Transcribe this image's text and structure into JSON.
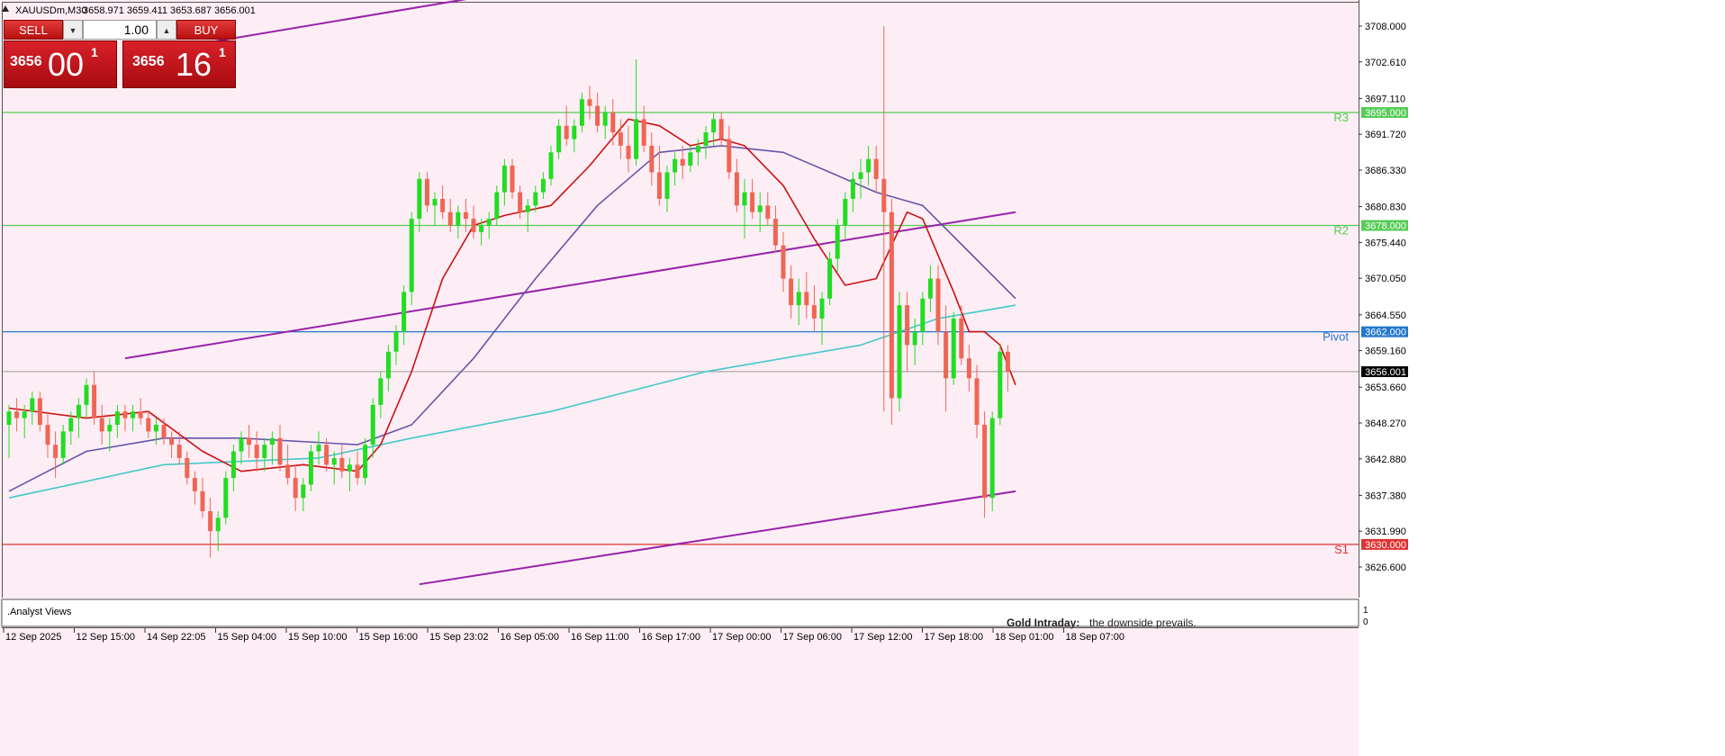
{
  "header": {
    "symbol_text": "XAUUSDm,M30",
    "ohlc_text": "3658.971 3659.411 3653.687 3656.001"
  },
  "trade_panel": {
    "sell_label": "SELL",
    "buy_label": "BUY",
    "lot_value": "1.00",
    "sell_price_big": "3656",
    "sell_price_large": "00",
    "sell_price_sup": "1",
    "buy_price_big": "3656",
    "buy_price_large": "16",
    "buy_price_sup": "1"
  },
  "colors": {
    "background": "#fdeef5",
    "bull": "#22dd22",
    "bear": "#ee6655",
    "ma_fast": "#cc1111",
    "ma_mid": "#6655aa",
    "ma_slow": "#44c8c8",
    "channel": "#9922aa",
    "r_line": "#55cc55",
    "s_line": "#dd3333",
    "pivot_line": "#2277cc"
  },
  "chart_data": {
    "type": "candlestick",
    "ylim": [
      3624.0,
      3712.0
    ],
    "price_ticks": [
      "3708.000",
      "3702.610",
      "3697.110",
      "3691.720",
      "3686.330",
      "3680.830",
      "3675.440",
      "3670.050",
      "3664.550",
      "3659.160",
      "3653.660",
      "3648.270",
      "3642.880",
      "3637.380",
      "3631.990",
      "3626.600"
    ],
    "time_labels": [
      "12 Sep 2025",
      "12 Sep 15:00",
      "14 Sep 22:05",
      "15 Sep 04:00",
      "15 Sep 10:00",
      "15 Sep 16:00",
      "15 Sep 23:02",
      "16 Sep 05:00",
      "16 Sep 11:00",
      "16 Sep 17:00",
      "17 Sep 00:00",
      "17 Sep 06:00",
      "17 Sep 12:00",
      "17 Sep 18:00",
      "18 Sep 01:00",
      "18 Sep 07:00"
    ],
    "levels": [
      {
        "name": "R3",
        "value": 3695.0,
        "label": "3695.000",
        "kind": "r"
      },
      {
        "name": "R2",
        "value": 3678.0,
        "label": "3678.000",
        "kind": "r"
      },
      {
        "name": "Pivot",
        "value": 3662.0,
        "label": "3662.000",
        "kind": "pivot"
      },
      {
        "name": "S1",
        "value": 3630.0,
        "label": "3630.000",
        "kind": "s"
      }
    ],
    "current_price": {
      "value": 3656.001,
      "label": "3656.001"
    },
    "candles": [
      [
        3648,
        3651,
        3643,
        3650
      ],
      [
        3650,
        3652,
        3647,
        3649
      ],
      [
        3649,
        3651,
        3646,
        3650
      ],
      [
        3650,
        3653,
        3648,
        3652
      ],
      [
        3652,
        3653,
        3647,
        3648
      ],
      [
        3648,
        3650,
        3643,
        3645
      ],
      [
        3645,
        3647,
        3640,
        3643
      ],
      [
        3643,
        3648,
        3642,
        3647
      ],
      [
        3647,
        3650,
        3645,
        3649
      ],
      [
        3649,
        3652,
        3646,
        3651
      ],
      [
        3651,
        3655,
        3649,
        3654
      ],
      [
        3654,
        3656,
        3648,
        3649
      ],
      [
        3649,
        3651,
        3645,
        3647
      ],
      [
        3647,
        3649,
        3644,
        3648
      ],
      [
        3648,
        3651,
        3646,
        3650
      ],
      [
        3650,
        3651,
        3647,
        3649
      ],
      [
        3649,
        3651,
        3647,
        3650
      ],
      [
        3650,
        3652,
        3648,
        3649
      ],
      [
        3649,
        3650,
        3646,
        3647
      ],
      [
        3647,
        3649,
        3645,
        3648
      ],
      [
        3648,
        3649,
        3645,
        3646
      ],
      [
        3646,
        3647,
        3643,
        3645
      ],
      [
        3645,
        3647,
        3642,
        3643
      ],
      [
        3643,
        3644,
        3639,
        3640
      ],
      [
        3640,
        3641,
        3636,
        3638
      ],
      [
        3638,
        3640,
        3634,
        3635
      ],
      [
        3635,
        3637,
        3628,
        3632
      ],
      [
        3632,
        3635,
        3629,
        3634
      ],
      [
        3634,
        3641,
        3633,
        3640
      ],
      [
        3640,
        3645,
        3638,
        3644
      ],
      [
        3644,
        3647,
        3642,
        3646
      ],
      [
        3646,
        3648,
        3643,
        3645
      ],
      [
        3645,
        3647,
        3641,
        3643
      ],
      [
        3643,
        3646,
        3641,
        3645
      ],
      [
        3645,
        3647,
        3642,
        3646
      ],
      [
        3646,
        3648,
        3641,
        3642
      ],
      [
        3642,
        3645,
        3639,
        3640
      ],
      [
        3640,
        3642,
        3635,
        3637
      ],
      [
        3637,
        3640,
        3635,
        3639
      ],
      [
        3639,
        3645,
        3638,
        3644
      ],
      [
        3644,
        3647,
        3642,
        3645
      ],
      [
        3645,
        3646,
        3641,
        3642
      ],
      [
        3642,
        3644,
        3639,
        3643
      ],
      [
        3643,
        3645,
        3640,
        3641
      ],
      [
        3641,
        3643,
        3638,
        3642
      ],
      [
        3642,
        3644,
        3639,
        3640
      ],
      [
        3640,
        3646,
        3639,
        3645
      ],
      [
        3645,
        3652,
        3643,
        3651
      ],
      [
        3651,
        3656,
        3649,
        3655
      ],
      [
        3655,
        3660,
        3653,
        3659
      ],
      [
        3659,
        3663,
        3657,
        3662
      ],
      [
        3662,
        3669,
        3660,
        3668
      ],
      [
        3668,
        3680,
        3666,
        3679
      ],
      [
        3679,
        3686,
        3677,
        3685
      ],
      [
        3685,
        3686,
        3680,
        3681
      ],
      [
        3681,
        3683,
        3678,
        3682
      ],
      [
        3682,
        3684,
        3679,
        3680
      ],
      [
        3680,
        3682,
        3677,
        3678
      ],
      [
        3678,
        3681,
        3676,
        3680
      ],
      [
        3680,
        3682,
        3677,
        3679
      ],
      [
        3679,
        3681,
        3676,
        3677
      ],
      [
        3677,
        3679,
        3675,
        3678
      ],
      [
        3678,
        3680,
        3676,
        3679
      ],
      [
        3679,
        3684,
        3678,
        3683
      ],
      [
        3683,
        3688,
        3681,
        3687
      ],
      [
        3687,
        3688,
        3682,
        3683
      ],
      [
        3683,
        3684,
        3679,
        3680
      ],
      [
        3680,
        3682,
        3677,
        3681
      ],
      [
        3681,
        3684,
        3680,
        3683
      ],
      [
        3683,
        3686,
        3682,
        3685
      ],
      [
        3685,
        3690,
        3684,
        3689
      ],
      [
        3689,
        3694,
        3688,
        3693
      ],
      [
        3693,
        3696,
        3690,
        3691
      ],
      [
        3691,
        3694,
        3689,
        3693
      ],
      [
        3693,
        3698,
        3692,
        3697
      ],
      [
        3697,
        3699,
        3694,
        3696
      ],
      [
        3696,
        3698,
        3692,
        3693
      ],
      [
        3693,
        3696,
        3691,
        3695
      ],
      [
        3695,
        3697,
        3690,
        3692
      ],
      [
        3692,
        3694,
        3688,
        3690
      ],
      [
        3690,
        3693,
        3686,
        3688
      ],
      [
        3688,
        3703,
        3687,
        3694
      ],
      [
        3694,
        3696,
        3689,
        3690
      ],
      [
        3690,
        3692,
        3684,
        3686
      ],
      [
        3686,
        3690,
        3681,
        3682
      ],
      [
        3682,
        3687,
        3680,
        3686
      ],
      [
        3686,
        3689,
        3684,
        3688
      ],
      [
        3688,
        3690,
        3685,
        3687
      ],
      [
        3687,
        3690,
        3686,
        3689
      ],
      [
        3689,
        3691,
        3687,
        3690
      ],
      [
        3690,
        3693,
        3688,
        3692
      ],
      [
        3692,
        3695,
        3690,
        3694
      ],
      [
        3694,
        3695,
        3690,
        3691
      ],
      [
        3691,
        3693,
        3685,
        3686
      ],
      [
        3686,
        3688,
        3680,
        3681
      ],
      [
        3681,
        3685,
        3676,
        3683
      ],
      [
        3683,
        3685,
        3679,
        3680
      ],
      [
        3680,
        3683,
        3677,
        3681
      ],
      [
        3681,
        3683,
        3678,
        3679
      ],
      [
        3679,
        3681,
        3674,
        3675
      ],
      [
        3675,
        3677,
        3668,
        3670
      ],
      [
        3670,
        3672,
        3664,
        3666
      ],
      [
        3666,
        3670,
        3663,
        3668
      ],
      [
        3668,
        3671,
        3664,
        3666
      ],
      [
        3666,
        3669,
        3662,
        3664
      ],
      [
        3664,
        3668,
        3660,
        3667
      ],
      [
        3667,
        3674,
        3666,
        3673
      ],
      [
        3673,
        3679,
        3671,
        3678
      ],
      [
        3678,
        3683,
        3676,
        3682
      ],
      [
        3682,
        3686,
        3680,
        3685
      ],
      [
        3685,
        3688,
        3682,
        3686
      ],
      [
        3686,
        3690,
        3684,
        3688
      ],
      [
        3688,
        3690,
        3683,
        3685
      ],
      [
        3685,
        3708,
        3650,
        3680
      ],
      [
        3680,
        3682,
        3648,
        3652
      ],
      [
        3652,
        3668,
        3650,
        3666
      ],
      [
        3666,
        3668,
        3656,
        3660
      ],
      [
        3660,
        3664,
        3657,
        3662
      ],
      [
        3662,
        3668,
        3660,
        3667
      ],
      [
        3667,
        3672,
        3665,
        3670
      ],
      [
        3670,
        3672,
        3660,
        3662
      ],
      [
        3662,
        3666,
        3650,
        3655
      ],
      [
        3655,
        3665,
        3654,
        3664
      ],
      [
        3664,
        3666,
        3657,
        3658
      ],
      [
        3658,
        3660,
        3653,
        3655
      ],
      [
        3655,
        3657,
        3646,
        3648
      ],
      [
        3648,
        3650,
        3634,
        3637
      ],
      [
        3637,
        3650,
        3635,
        3649
      ],
      [
        3649,
        3660,
        3648,
        3659
      ],
      [
        3659,
        3660,
        3653,
        3656
      ]
    ],
    "ma_fast": [
      [
        0,
        3650.5
      ],
      [
        10,
        3649
      ],
      [
        18,
        3650
      ],
      [
        25,
        3644
      ],
      [
        30,
        3641
      ],
      [
        38,
        3642
      ],
      [
        45,
        3641
      ],
      [
        48,
        3645
      ],
      [
        52,
        3656
      ],
      [
        56,
        3670
      ],
      [
        60,
        3678
      ],
      [
        64,
        3679.5
      ],
      [
        70,
        3681
      ],
      [
        75,
        3687
      ],
      [
        80,
        3694
      ],
      [
        84,
        3693
      ],
      [
        88,
        3690
      ],
      [
        92,
        3691
      ],
      [
        95,
        3690
      ],
      [
        100,
        3684
      ],
      [
        104,
        3676
      ],
      [
        108,
        3669
      ],
      [
        112,
        3670
      ],
      [
        116,
        3680
      ],
      [
        118,
        3679
      ],
      [
        122,
        3668
      ],
      [
        124,
        3662
      ],
      [
        126,
        3662
      ],
      [
        128,
        3660
      ],
      [
        130,
        3654
      ]
    ],
    "ma_mid": [
      [
        0,
        3638
      ],
      [
        10,
        3644
      ],
      [
        20,
        3646
      ],
      [
        30,
        3646
      ],
      [
        45,
        3645
      ],
      [
        52,
        3648
      ],
      [
        60,
        3658
      ],
      [
        68,
        3670
      ],
      [
        76,
        3681
      ],
      [
        84,
        3689
      ],
      [
        92,
        3690
      ],
      [
        100,
        3689
      ],
      [
        106,
        3686
      ],
      [
        112,
        3683
      ],
      [
        118,
        3681
      ],
      [
        124,
        3674
      ],
      [
        130,
        3667
      ]
    ],
    "ma_slow": [
      [
        0,
        3637
      ],
      [
        20,
        3642
      ],
      [
        40,
        3643
      ],
      [
        52,
        3646
      ],
      [
        70,
        3650
      ],
      [
        90,
        3656
      ],
      [
        110,
        3660
      ],
      [
        120,
        3664
      ],
      [
        130,
        3666
      ]
    ],
    "channel_lines": [
      {
        "p1": [
          15,
          3658
        ],
        "p2": [
          130,
          3680
        ]
      },
      {
        "p1": [
          53,
          3624
        ],
        "p2": [
          130,
          3638
        ]
      },
      {
        "p1": [
          23,
          3705
        ],
        "p2": [
          69,
          3714
        ]
      }
    ],
    "indicator_label": ".Analyst Views",
    "indicator_text": "Gold Intraday:",
    "indicator_text2": "the downside prevails.",
    "indicator_ticks": [
      "1",
      "0"
    ]
  }
}
